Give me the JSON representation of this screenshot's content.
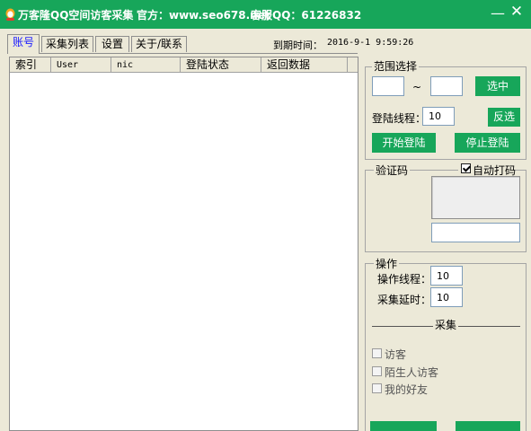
{
  "window": {
    "title": "万客隆QQ空间访客采集",
    "site": "官方：www.seo678.net",
    "support": "客服QQ：61226832",
    "minimize": "—",
    "close": "✕"
  },
  "tabs": [
    {
      "label": "账号",
      "active": true
    },
    {
      "label": "采集列表",
      "active": false
    },
    {
      "label": "设置",
      "active": false
    },
    {
      "label": "关于/联系",
      "active": false
    }
  ],
  "expire": {
    "label": "到期时间：",
    "value": "2016-9-1 9:59:26"
  },
  "table": {
    "columns": [
      "索引",
      "User",
      "nic",
      "登陆状态",
      "返回数据"
    ],
    "rows": []
  },
  "range": {
    "title": "范围选择",
    "from": "",
    "sep": "~",
    "to": "",
    "select_btn": "选中",
    "threads_label": "登陆线程：",
    "threads": "10",
    "invert_btn": "反选",
    "start_btn": "开始登陆",
    "stop_btn": "停止登陆"
  },
  "captcha": {
    "title": "验证码",
    "auto_label": "自动打码",
    "auto_checked": true,
    "input": ""
  },
  "ops": {
    "title": "操作",
    "threads_label": "操作线程：",
    "threads": "10",
    "delay_label": "采集延时：",
    "delay": "10",
    "collect_label": "采集",
    "options": [
      {
        "label": "访客",
        "checked": false
      },
      {
        "label": "陌生人访客",
        "checked": false
      },
      {
        "label": "我的好友",
        "checked": false
      }
    ]
  },
  "colors": {
    "accent": "#17a65a",
    "background": "#ece9d8",
    "tab_active_text": "#1a1aff"
  }
}
